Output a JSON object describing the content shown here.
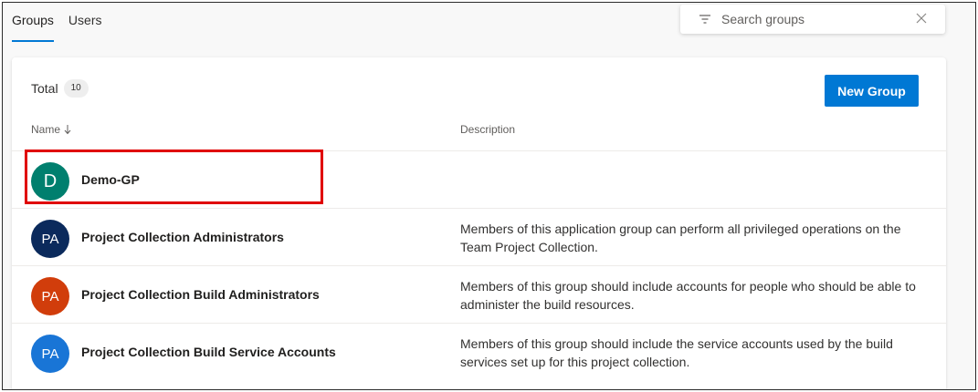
{
  "tabs": [
    {
      "label": "Groups",
      "active": true
    },
    {
      "label": "Users",
      "active": false
    }
  ],
  "search": {
    "placeholder": "Search groups"
  },
  "summary": {
    "total_label": "Total",
    "total_count": "10"
  },
  "actions": {
    "new_group_label": "New Group"
  },
  "columns": {
    "name": "Name",
    "description": "Description"
  },
  "groups": [
    {
      "initials": "D",
      "name": "Demo-GP",
      "description": "",
      "color": "#007f6e",
      "highlighted": true
    },
    {
      "initials": "PA",
      "name": "Project Collection Administrators",
      "description": "Members of this application group can perform all privileged operations on the Team Project Collection.",
      "color": "#0b2a5c"
    },
    {
      "initials": "PA",
      "name": "Project Collection Build Administrators",
      "description": "Members of this group should include accounts for people who should be able to administer the build resources.",
      "color": "#d13d0b"
    },
    {
      "initials": "PA",
      "name": "Project Collection Build Service Accounts",
      "description": "Members of this group should include the service accounts used by the build services set up for this project collection.",
      "color": "#1975d6"
    }
  ],
  "colors": {
    "accent": "#0078d4",
    "highlight": "#e00000"
  },
  "icons": {
    "filter": "filter-icon",
    "close": "close-icon",
    "sort": "sort-down-arrow-icon"
  }
}
